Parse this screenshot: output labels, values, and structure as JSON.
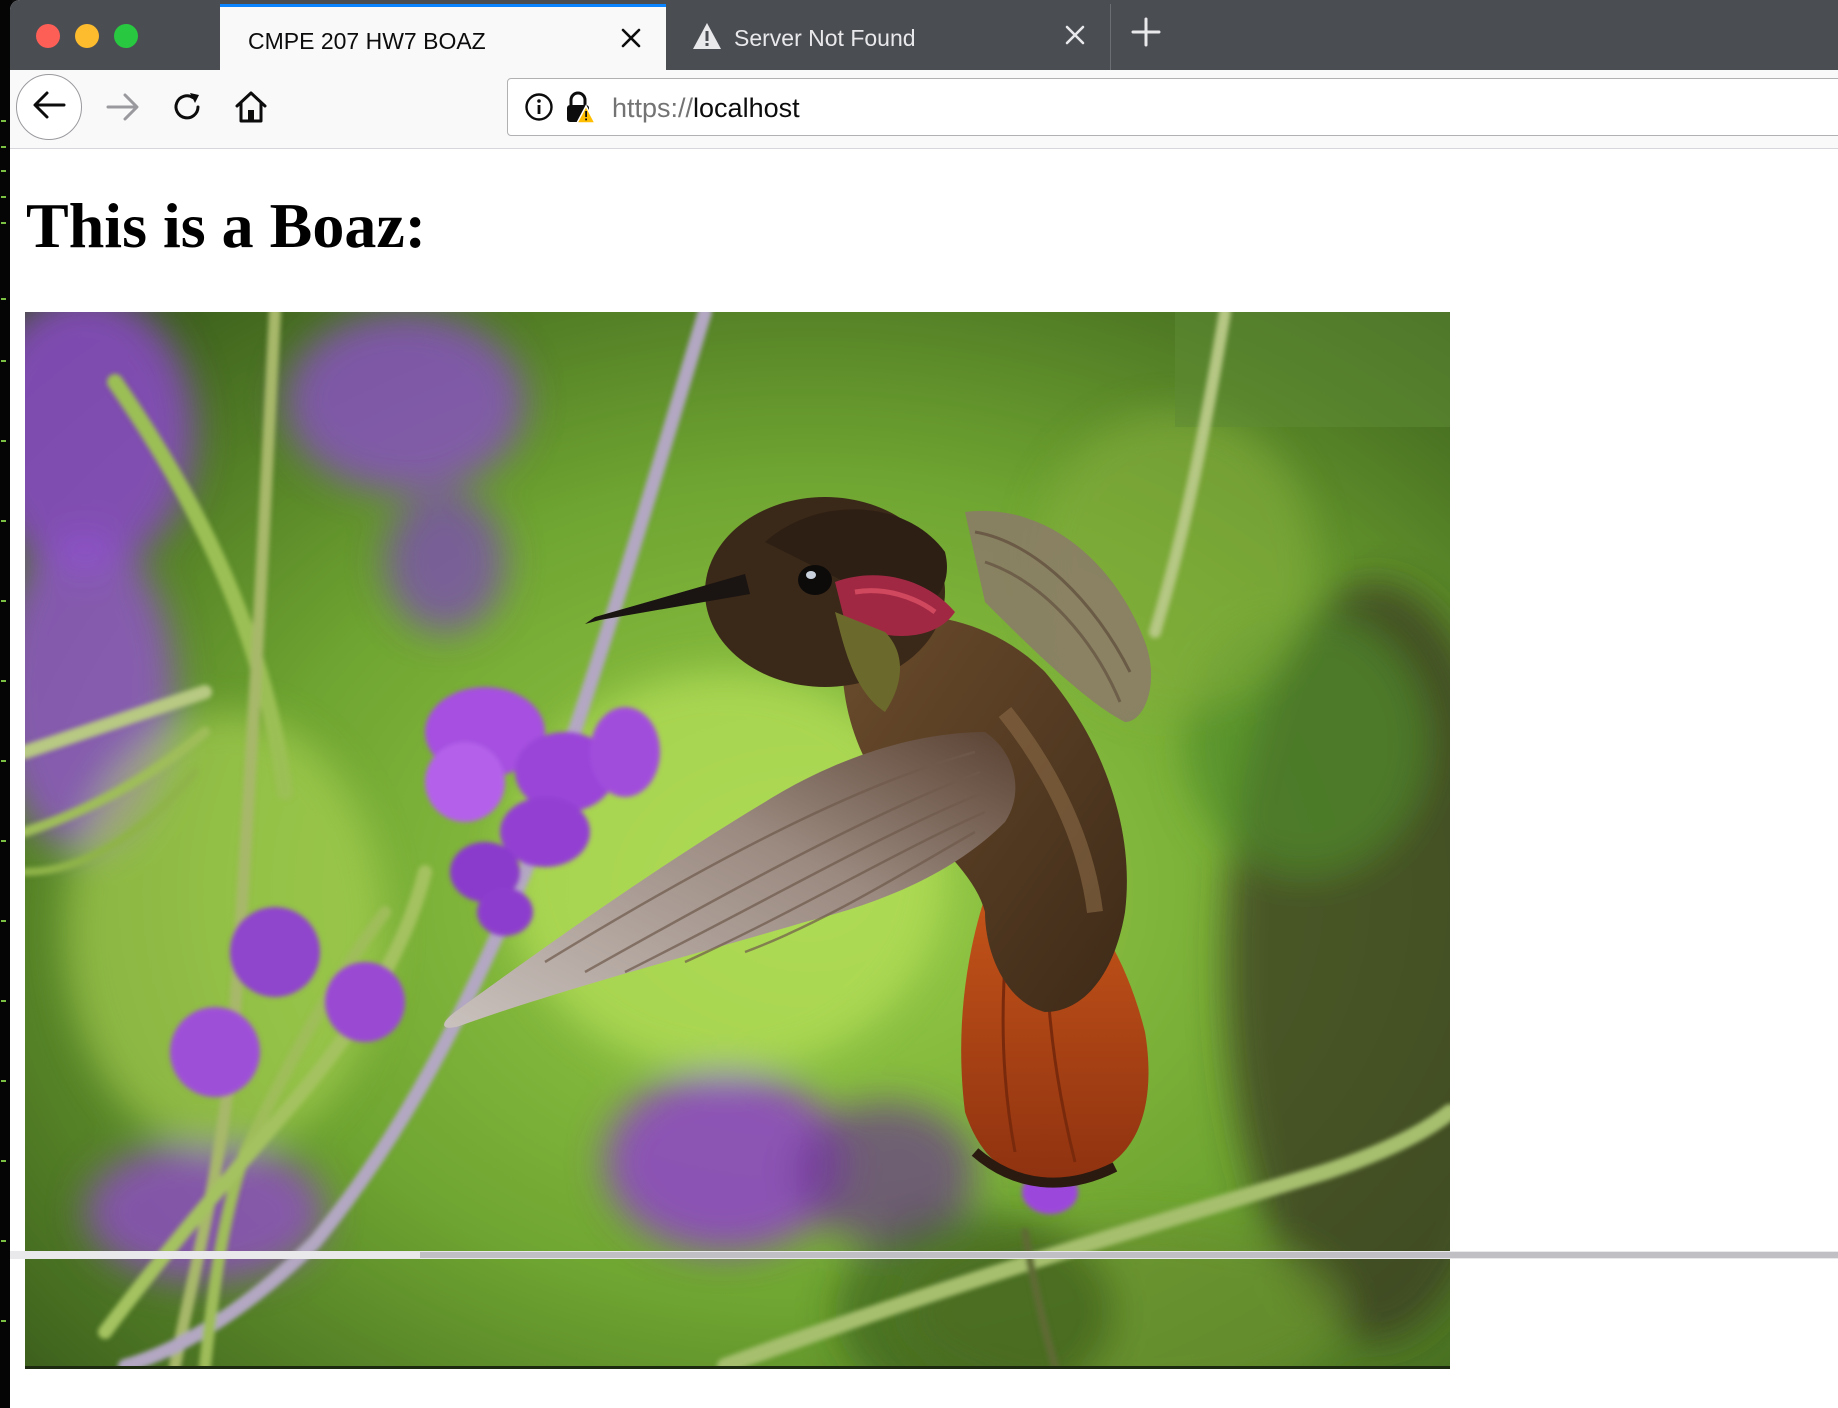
{
  "browser": {
    "tabs": [
      {
        "title": "CMPE 207 HW7 BOAZ",
        "active": true
      },
      {
        "title": "Server Not Found",
        "active": false,
        "icon": "warning-icon"
      }
    ],
    "new_tab_icon": "plus-icon",
    "nav": {
      "back_icon": "back-arrow-icon",
      "forward_icon": "forward-arrow-icon",
      "reload_icon": "reload-icon",
      "home_icon": "home-icon"
    },
    "url": {
      "scheme": "https://",
      "host": "localhost"
    }
  },
  "page": {
    "heading": "This is a Boaz:",
    "image_subject": "hummingbird-photo"
  },
  "colors": {
    "tab_accent": "#0a84ff",
    "tabbar_bg": "#4a4d52",
    "close_red": "#fd5f57",
    "minimize_yellow": "#fdbb2e",
    "zoom_green": "#28c840"
  }
}
